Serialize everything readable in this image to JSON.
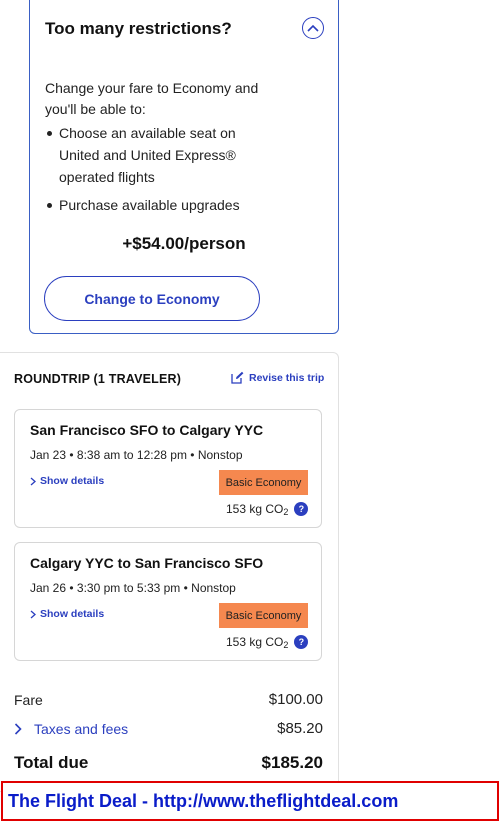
{
  "upsell": {
    "title": "Too many restrictions?",
    "description": "Change your fare to Economy and you'll be able to:",
    "benefits": [
      "Choose an available seat on United and United Express® operated flights",
      "Purchase available upgrades"
    ],
    "price": "+$54.00/person",
    "button_label": "Change to Economy"
  },
  "summary": {
    "heading": "ROUNDTRIP (1 TRAVELER)",
    "revise_label": "Revise this trip",
    "flights": [
      {
        "route": "San Francisco SFO to Calgary YYC",
        "time": "Jan 23 • 8:38 am to 12:28 pm • Nonstop",
        "details_label": "Show details",
        "fare_class": "Basic Economy",
        "co2": "153 kg CO",
        "co2_sub": "2",
        "help": "?"
      },
      {
        "route": "Calgary YYC to San Francisco SFO",
        "time": "Jan 26 • 3:30 pm to 5:33 pm • Nonstop",
        "details_label": "Show details",
        "fare_class": "Basic Economy",
        "co2": "153 kg CO",
        "co2_sub": "2",
        "help": "?"
      }
    ],
    "fare_label": "Fare",
    "fare_value": "$100.00",
    "taxes_label": "Taxes and fees",
    "taxes_value": "$85.20",
    "total_label": "Total due",
    "total_value": "$185.20"
  },
  "watermark": "The Flight Deal - http://www.theflightdeal.com",
  "colors": {
    "accent": "#2b3fbf",
    "badge": "#f5884f",
    "watermark_border": "#e00000",
    "watermark_text": "#0a1cc9"
  },
  "icons": [
    "chevron-up-icon",
    "edit-icon",
    "chevron-right-icon",
    "help-icon"
  ]
}
